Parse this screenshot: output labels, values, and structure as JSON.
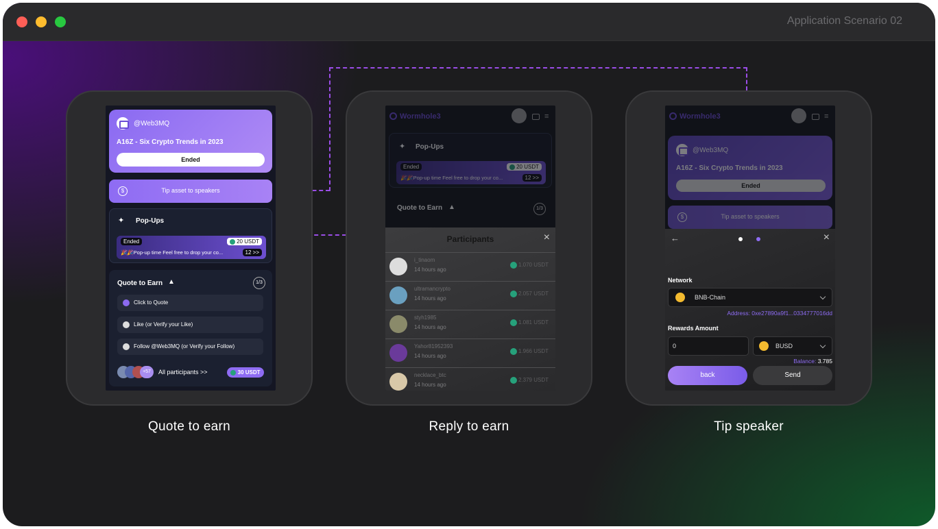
{
  "window": {
    "title": "Application Scenario 02"
  },
  "cards": [
    {
      "caption": "Quote to earn"
    },
    {
      "caption": "Reply to earn"
    },
    {
      "caption": "Tip speaker"
    }
  ],
  "p1": {
    "handle": "@Web3MQ",
    "title": "A16Z - Six Crypto Trends in 2023",
    "ended": "Ended",
    "tip": "Tip asset to speakers",
    "popups": "Pop-Ups",
    "evt_ended": "Ended",
    "evt_amount": "20 USDT",
    "evt_text": "🎉🎉Pop-up time Feel free to drop your co...",
    "evt_count": "12 >>",
    "qte": "Quote to Earn",
    "qte_page": "1/3",
    "rows": [
      "Click to Quote",
      "Like (or Verify your Like)",
      "Follow @Web3MQ (or Verify your Follow)"
    ],
    "more": "+57",
    "all": "All participants >>",
    "reward": "30 USDT"
  },
  "p2": {
    "brand": "Wormhole3",
    "popups": "Pop-Ups",
    "evt_ended": "Ended",
    "evt_amount": "20 USDT",
    "evt_text": "🎉🎉Pop-up time Feel free to drop your co...",
    "evt_count": "12 >>",
    "qte": "Quote to Earn",
    "qte_page": "1/3",
    "sheet_title": "Participants",
    "participants": [
      {
        "name": "i_tinaom",
        "time": "14 hours ago",
        "amount": "1.070 USDT"
      },
      {
        "name": "ultramancrypto",
        "time": "14 hours ago",
        "amount": "2.057 USDT"
      },
      {
        "name": "styh1985",
        "time": "14 hours ago",
        "amount": "1.081 USDT"
      },
      {
        "name": "Yahor81952393",
        "time": "14 hours ago",
        "amount": "1.966 USDT"
      },
      {
        "name": "necklace_btc",
        "time": "14 hours ago",
        "amount": "2.379 USDT"
      }
    ]
  },
  "p3": {
    "brand": "Wormhole3",
    "handle": "@Web3MQ",
    "title": "A16Z - Six Crypto Trends in 2023",
    "ended": "Ended",
    "tip": "Tip asset to speakers",
    "network_label": "Network",
    "network": "BNB-Chain",
    "address": "Address: 0xe27890a9f1...0334777016dd",
    "amount_label": "Rewards Amount",
    "amount": "0",
    "token": "BUSD",
    "balance_label": "Balance:",
    "balance": "3.785",
    "back": "back",
    "send": "Send"
  },
  "colors": {
    "accent": "#8e6cf3",
    "window_bg": "#1c1c1e",
    "titlebar": "#2a2a2c"
  }
}
